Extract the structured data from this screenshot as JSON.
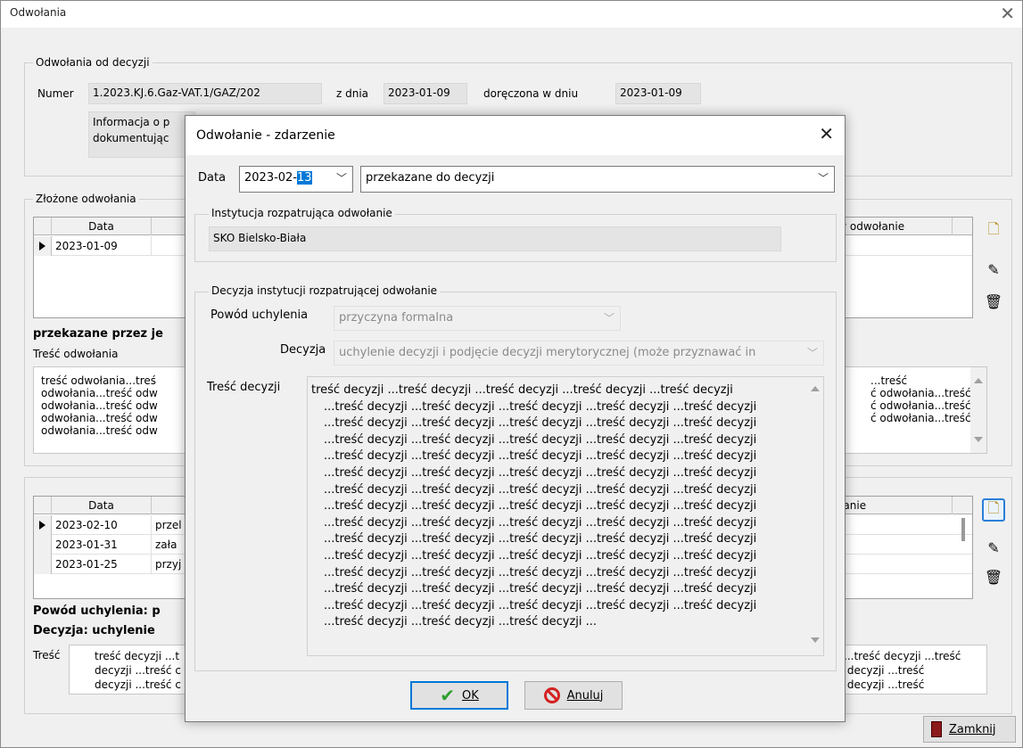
{
  "main_window": {
    "title": "Odwołania",
    "decyzja_group": "Odwołania od decyzji",
    "numer_label": "Numer",
    "numer_value": "1.2023.KJ.6.Gaz-VAT.1/GAZ/202",
    "z_dnia_label": "z dnia",
    "z_dnia_value": "2023-01-09",
    "doreczona_label": "doręczona w dniu",
    "doreczona_value": "2023-01-09",
    "info_line1": "Informacja o p",
    "info_line2": "dokumentując",
    "zlozone_group": "Złożone odwołania",
    "grid1": {
      "col_data": "Data",
      "col_last": "y odwołanie",
      "rows": [
        {
          "data": "2023-01-09"
        }
      ]
    },
    "przekazane_bold": "przekazane przez je",
    "tresc_odwolania_label": "Treść odwołania",
    "tresc_odwolania_left": "treść odwołania...treś\nodwołania...treść odw\nodwołania...treść odw\nodwołania...treść odw\nodwołania...treść odw",
    "tresc_odwolania_right": "...treść\nć odwołania...treść\nć odwołania...treść\nć odwołania...treść",
    "grid2": {
      "col_data": "Data",
      "col_last": "łanie",
      "rows": [
        {
          "data": "2023-02-10",
          "desc": "przel"
        },
        {
          "data": "2023-01-31",
          "desc": "zała"
        },
        {
          "data": "2023-01-25",
          "desc": "przyj"
        }
      ]
    },
    "powod_bold": "Powód uchylenia: p",
    "decyzja_bold": "Decyzja: uchylenie",
    "tresc_label": "Treść",
    "tresc_left": "treść decyzji ...t\ndecyzji ...treść c\ndecyzji ...treść c",
    "tresc_right": "...treść decyzji ...treść\n decyzji ...treść\n decyzji ...treść",
    "close_button": "Zamknij"
  },
  "dialog": {
    "title": "Odwołanie - zdarzenie",
    "data_label": "Data",
    "date_prefix": "2023-02-",
    "date_selected": "13",
    "event_type": "przekazane do decyzji",
    "instytucja_group": "Instytucja rozpatrująca odwołanie",
    "instytucja_value": "SKO Bielsko-Biała",
    "decyzja_group": "Decyzja instytucji rozpatrującej odwołanie",
    "powod_label": "Powód uchylenia",
    "powod_value": "przyczyna formalna",
    "decyzja_label": "Decyzja",
    "decyzja_value": "uchylenie decyzji i podjęcie decyzji merytorycznej (może przyznawać in",
    "tresc_label": "Treść decyzji",
    "tresc_lines": [
      "treść decyzji ...treść decyzji ...treść decyzji ...treść decyzji ...treść decyzji",
      "...treść decyzji ...treść decyzji ...treść decyzji ...treść decyzji ...treść decyzji",
      "...treść decyzji ...treść decyzji ...treść decyzji ...treść decyzji ...treść decyzji",
      "...treść decyzji ...treść decyzji ...treść decyzji ...treść decyzji ...treść decyzji",
      "...treść decyzji ...treść decyzji ...treść decyzji ...treść decyzji ...treść decyzji",
      "...treść decyzji ...treść decyzji ...treść decyzji ...treść decyzji ...treść decyzji",
      "...treść decyzji ...treść decyzji ...treść decyzji ...treść decyzji ...treść decyzji",
      "...treść decyzji ...treść decyzji ...treść decyzji ...treść decyzji ...treść decyzji",
      "...treść decyzji ...treść decyzji ...treść decyzji ...treść decyzji ...treść decyzji",
      "...treść decyzji ...treść decyzji ...treść decyzji ...treść decyzji ...treść decyzji",
      "...treść decyzji ...treść decyzji ...treść decyzji ...treść decyzji ...treść decyzji",
      "...treść decyzji ...treść decyzji ...treść decyzji ...treść decyzji ...treść decyzji",
      "...treść decyzji ...treść decyzji ...treść decyzji ...treść decyzji ...treść decyzji",
      "...treść decyzji ...treść decyzji ...treść decyzji ...treść decyzji ...treść decyzji",
      "...treść decyzji ...treść decyzji ...treść decyzji ..."
    ],
    "ok_button": "OK",
    "cancel_button": "Anuluj"
  },
  "colors": {
    "selection": "#0078d7",
    "ok_check": "#2e9e2e",
    "cancel_red": "#d42020"
  }
}
